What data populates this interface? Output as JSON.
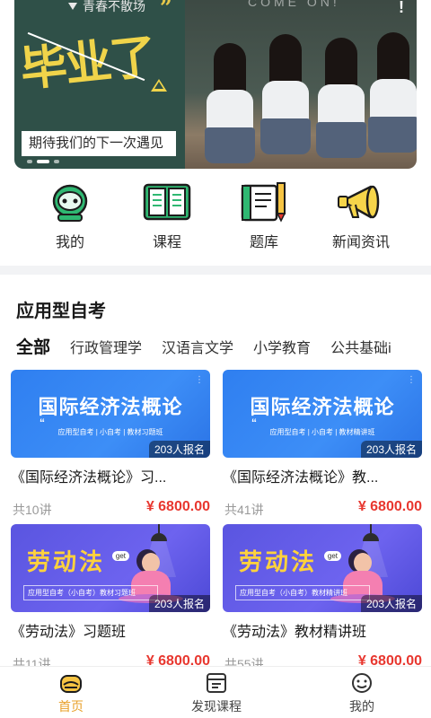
{
  "banner": {
    "tagline": "青春不散场",
    "headline": "毕业了",
    "subtitle": "期待我们的下一次遇见",
    "right_text": "COME ON!",
    "page_count": 3,
    "active_page": 2
  },
  "quick_nav": [
    {
      "label": "我的",
      "icon": "robot-face-icon"
    },
    {
      "label": "课程",
      "icon": "open-book-icon"
    },
    {
      "label": "题库",
      "icon": "notebook-pencil-icon"
    },
    {
      "label": "新闻资讯",
      "icon": "megaphone-icon"
    }
  ],
  "section": {
    "title": "应用型自考",
    "tabs": [
      "全部",
      "行政管理学",
      "汉语言文学",
      "小学教育",
      "公共基础i"
    ],
    "active_tab": 0
  },
  "courses": [
    {
      "cover_title": "国际经济法概论",
      "cover_sub": "应用型自考 | 小自考 | 教材习题班",
      "enroll": "203人报名",
      "title": "《国际经济法概论》习...",
      "lessons": "共10讲",
      "price": "¥ 6800.00",
      "theme": "blue"
    },
    {
      "cover_title": "国际经济法概论",
      "cover_sub": "应用型自考 | 小自考 | 教材精讲班",
      "enroll": "203人报名",
      "title": "《国际经济法概论》教...",
      "lessons": "共41讲",
      "price": "¥ 6800.00",
      "theme": "blue"
    },
    {
      "cover_title": "劳动法",
      "cover_sub": "应用型自考（小自考）教材习题班",
      "enroll": "203人报名",
      "title": "《劳动法》习题班",
      "lessons": "共11讲",
      "price": "¥ 6800.00",
      "theme": "purple"
    },
    {
      "cover_title": "劳动法",
      "cover_sub": "应用型自考（小自考）教材精讲班",
      "enroll": "203人报名",
      "title": "《劳动法》教材精讲班",
      "lessons": "共55讲",
      "price": "¥ 6800.00",
      "theme": "purple"
    }
  ],
  "bottom_nav": [
    {
      "label": "首页",
      "icon": "home-cap-icon",
      "active": true
    },
    {
      "label": "发现课程",
      "icon": "course-list-icon",
      "active": false
    },
    {
      "label": "我的",
      "icon": "smiley-face-icon",
      "active": false
    }
  ],
  "colors": {
    "accent": "#e8a02a",
    "price": "#e8372f",
    "banner_bg": "#2f5048",
    "banner_headline": "#f0d44a",
    "cover_blue": "#2f7ff0",
    "cover_purple": "#5a55e0",
    "icon_green": "#2fb872"
  }
}
